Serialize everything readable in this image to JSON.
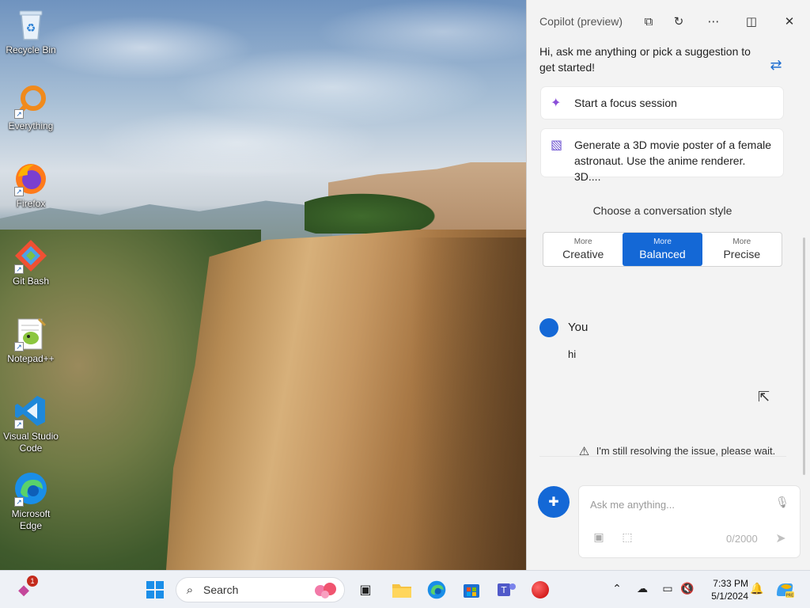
{
  "desktop": {
    "icons": [
      {
        "label": "Recycle Bin",
        "icon": "recycle-bin-icon"
      },
      {
        "label": "Everything",
        "icon": "everything-search-icon"
      },
      {
        "label": "Firefox",
        "icon": "firefox-icon"
      },
      {
        "label": "Git Bash",
        "icon": "git-bash-icon"
      },
      {
        "label": "Notepad++",
        "icon": "notepad-plus-plus-icon"
      },
      {
        "label": "Visual Studio Code",
        "icon": "vscode-icon"
      },
      {
        "label": "Microsoft Edge",
        "icon": "edge-icon"
      }
    ]
  },
  "copilot": {
    "title": "Copilot (preview)",
    "greeting": "Hi, ask me anything or pick a suggestion to get started!",
    "suggestions": [
      {
        "text": "Start a focus session",
        "icon": "sparkle-icon"
      },
      {
        "text": "Generate a 3D movie poster of a female astronaut. Use the anime renderer. 3D....",
        "icon": "image-create-icon"
      }
    ],
    "style_title": "Choose a conversation style",
    "styles": [
      {
        "small": "More",
        "big": "Creative",
        "selected": false
      },
      {
        "small": "More",
        "big": "Balanced",
        "selected": true
      },
      {
        "small": "More",
        "big": "Precise",
        "selected": false
      }
    ],
    "user_name": "You",
    "user_message": "hi",
    "warning": "I'm still resolving the issue, please wait.",
    "input_placeholder": "Ask me anything...",
    "char_counter": "0/2000",
    "accent_color": "#1468d6"
  },
  "taskbar": {
    "search_label": "Search",
    "notification_count": "1",
    "time": "7:33 PM",
    "date": "5/1/2024"
  }
}
